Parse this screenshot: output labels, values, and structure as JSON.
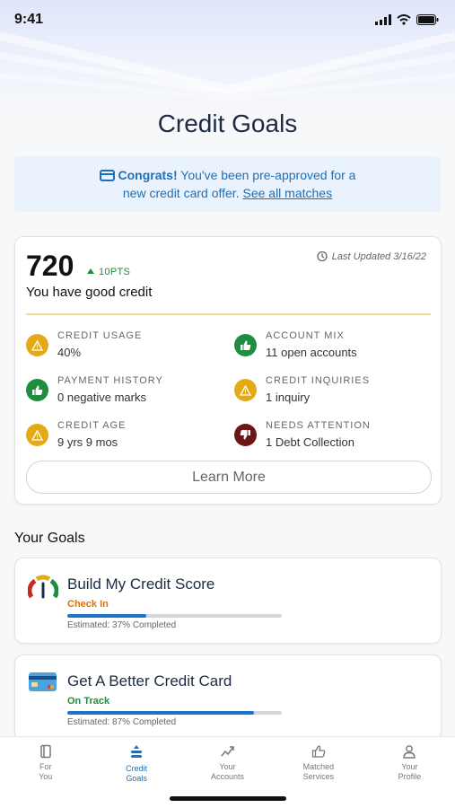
{
  "status_bar": {
    "time": "9:41"
  },
  "page_title": "Credit Goals",
  "promo": {
    "bold": "Congrats!",
    "text": " You've been pre-approved for a new credit card offer. ",
    "link": "See all matches"
  },
  "credit": {
    "score": "720",
    "change": "10PTS",
    "updated": "Last Updated 3/16/22",
    "label": "You have good credit",
    "factors": [
      {
        "name": "Credit Usage",
        "value": "40%",
        "status": "warn"
      },
      {
        "name": "Account Mix",
        "value": "11 open accounts",
        "status": "good"
      },
      {
        "name": "Payment History",
        "value": "0 negative marks",
        "status": "good"
      },
      {
        "name": "Credit Inquiries",
        "value": "1 inquiry",
        "status": "warn"
      },
      {
        "name": "Credit Age",
        "value": "9 yrs 9 mos",
        "status": "warn"
      },
      {
        "name": "Needs Attention",
        "value": "1 Debt Collection",
        "status": "bad"
      }
    ],
    "learn_more": "Learn More"
  },
  "goals": {
    "heading": "Your Goals",
    "items": [
      {
        "title": "Build My Credit Score",
        "status": "Check In",
        "status_color": "#d9730d",
        "progress": 0.37,
        "estimate": "Estimated: 37% Completed",
        "icon": "gauge-icon"
      },
      {
        "title": "Get A Better Credit Card",
        "status": "On Track",
        "status_color": "#1e8e3e",
        "progress": 0.87,
        "estimate": "Estimated: 87% Completed",
        "icon": "credit-card-icon"
      }
    ]
  },
  "tabs": [
    {
      "label": "For\nYou",
      "icon": "book-icon",
      "active": false
    },
    {
      "label": "Credit\nGoals",
      "icon": "goals-icon",
      "active": true
    },
    {
      "label": "Your\nAccounts",
      "icon": "trend-icon",
      "active": false
    },
    {
      "label": "Matched\nServices",
      "icon": "thumbs-up-icon",
      "active": false
    },
    {
      "label": "Your\nProfile",
      "icon": "person-icon",
      "active": false
    }
  ],
  "colors": {
    "accent": "#1f6fb8",
    "warn": "#e3a917",
    "good": "#1e8e3e",
    "bad": "#6d1414"
  }
}
